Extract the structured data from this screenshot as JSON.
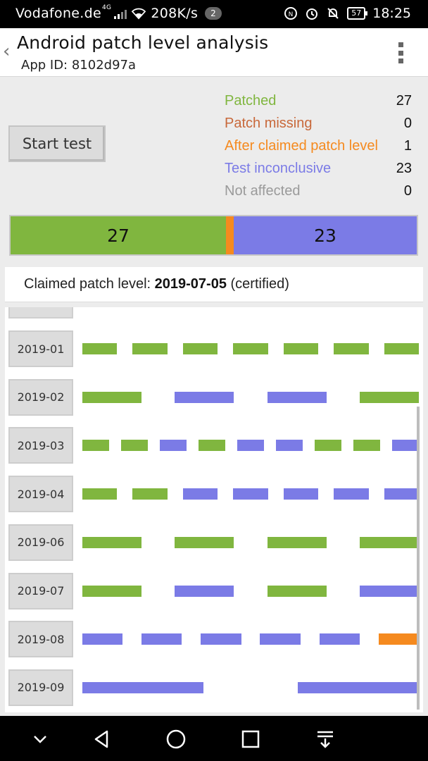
{
  "status_bar": {
    "carrier": "Vodafone.de",
    "network": "4G",
    "speed": "208K/s",
    "notif_count": "2",
    "battery": "57",
    "time": "18:25"
  },
  "app_bar": {
    "title": "Android patch level analysis",
    "subtitle": "App ID: 8102d97a"
  },
  "start_button_label": "Start test",
  "legend": [
    {
      "label": "Patched",
      "count": "27",
      "color": "#80b63f"
    },
    {
      "label": "Patch missing",
      "count": "0",
      "color": "#c8683a"
    },
    {
      "label": "After claimed patch level",
      "count": "1",
      "color": "#f58a1f"
    },
    {
      "label": "Test inconclusive",
      "count": "23",
      "color": "#7b7be6"
    },
    {
      "label": "Not affected",
      "count": "0",
      "color": "#9a9a9a"
    }
  ],
  "summary_bar": {
    "patched": 27,
    "after": 1,
    "inconclusive": 23,
    "patched_label": "27",
    "inconclusive_label": "23"
  },
  "claimed": {
    "prefix": "Claimed patch level: ",
    "date": "2019-07-05",
    "suffix": " (certified)"
  },
  "months": [
    {
      "label": "2019-01",
      "tests": [
        "patched",
        "patched",
        "patched",
        "patched",
        "patched",
        "patched",
        "patched"
      ]
    },
    {
      "label": "2019-02",
      "tests": [
        "patched",
        "inconclusive",
        "inconclusive",
        "patched"
      ]
    },
    {
      "label": "2019-03",
      "tests": [
        "patched",
        "patched",
        "inconclusive",
        "patched",
        "inconclusive",
        "inconclusive",
        "patched",
        "patched",
        "inconclusive"
      ]
    },
    {
      "label": "2019-04",
      "tests": [
        "patched",
        "patched",
        "inconclusive",
        "inconclusive",
        "inconclusive",
        "inconclusive",
        "inconclusive"
      ]
    },
    {
      "label": "2019-06",
      "tests": [
        "patched",
        "patched",
        "patched",
        "patched"
      ]
    },
    {
      "label": "2019-07",
      "tests": [
        "patched",
        "inconclusive",
        "patched",
        "inconclusive"
      ]
    },
    {
      "label": "2019-08",
      "tests": [
        "inconclusive",
        "inconclusive",
        "inconclusive",
        "inconclusive",
        "inconclusive",
        "after"
      ]
    },
    {
      "label": "2019-09",
      "tests": [
        "inconclusive",
        "inconclusive"
      ]
    }
  ],
  "colors": {
    "patched": "#80b63f",
    "inconclusive": "#7b7be6",
    "after": "#f58a1f",
    "missing": "#c8683a",
    "not_affected": "#9a9a9a"
  },
  "icons": [
    "back-chevron-icon",
    "overflow-menu-icon",
    "nav-down-icon",
    "nav-back-icon",
    "nav-home-icon",
    "nav-recents-icon",
    "nav-notifications-icon"
  ]
}
